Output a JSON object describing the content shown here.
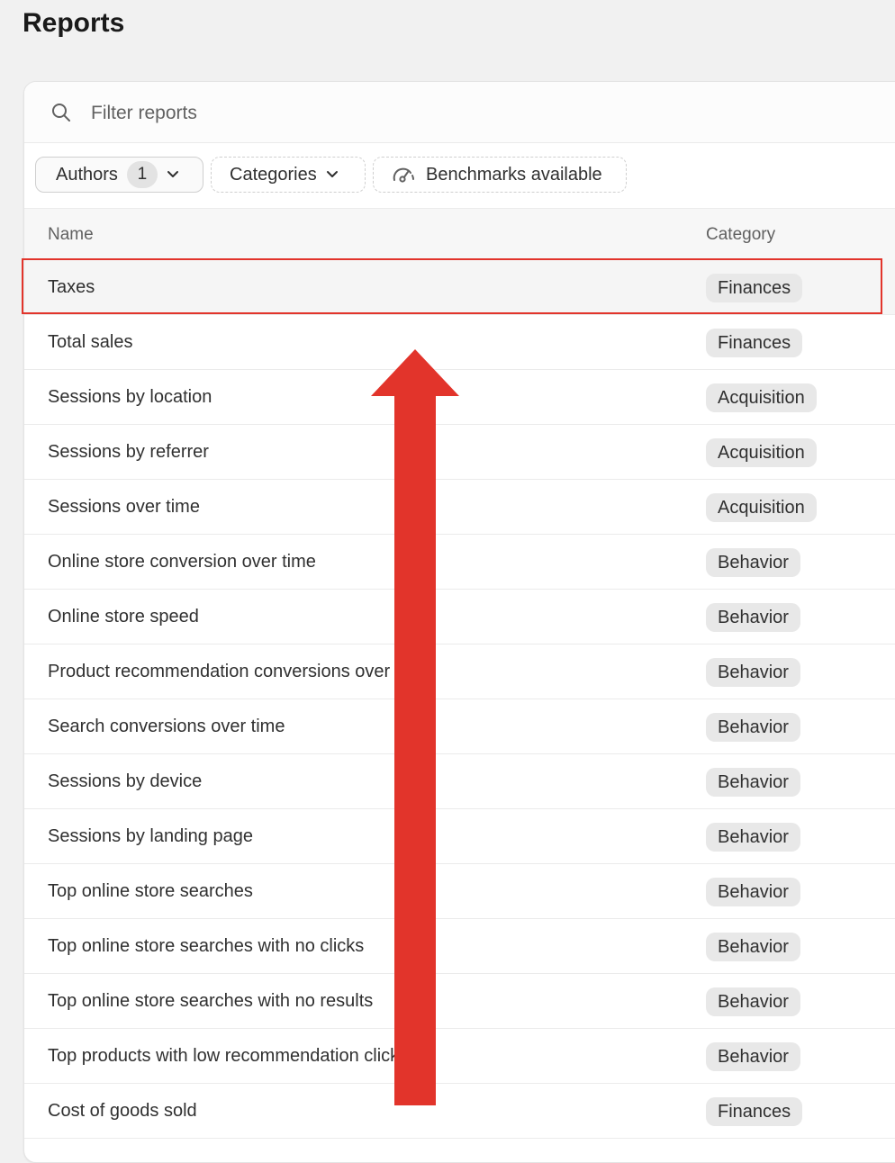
{
  "page": {
    "title": "Reports"
  },
  "search": {
    "placeholder": "Filter reports",
    "icon": "search-icon"
  },
  "filters": {
    "authors_label": "Authors",
    "authors_count": "1",
    "categories_label": "Categories",
    "benchmarks_label": "Benchmarks available"
  },
  "table": {
    "headers": {
      "name": "Name",
      "category": "Category"
    },
    "rows": [
      {
        "name": "Taxes",
        "category": "Finances"
      },
      {
        "name": "Total sales",
        "category": "Finances"
      },
      {
        "name": "Sessions by location",
        "category": "Acquisition"
      },
      {
        "name": "Sessions by referrer",
        "category": "Acquisition"
      },
      {
        "name": "Sessions over time",
        "category": "Acquisition"
      },
      {
        "name": "Online store conversion over time",
        "category": "Behavior"
      },
      {
        "name": "Online store speed",
        "category": "Behavior"
      },
      {
        "name": "Product recommendation conversions over time",
        "category": "Behavior"
      },
      {
        "name": "Search conversions over time",
        "category": "Behavior"
      },
      {
        "name": "Sessions by device",
        "category": "Behavior"
      },
      {
        "name": "Sessions by landing page",
        "category": "Behavior"
      },
      {
        "name": "Top online store searches",
        "category": "Behavior"
      },
      {
        "name": "Top online store searches with no clicks",
        "category": "Behavior"
      },
      {
        "name": "Top online store searches with no results",
        "category": "Behavior"
      },
      {
        "name": "Top products with low recommendation click rate",
        "category": "Behavior"
      },
      {
        "name": "Cost of goods sold",
        "category": "Finances"
      }
    ]
  },
  "annotation": {
    "highlight_color": "#e2342b",
    "highlighted_row": "Taxes"
  }
}
